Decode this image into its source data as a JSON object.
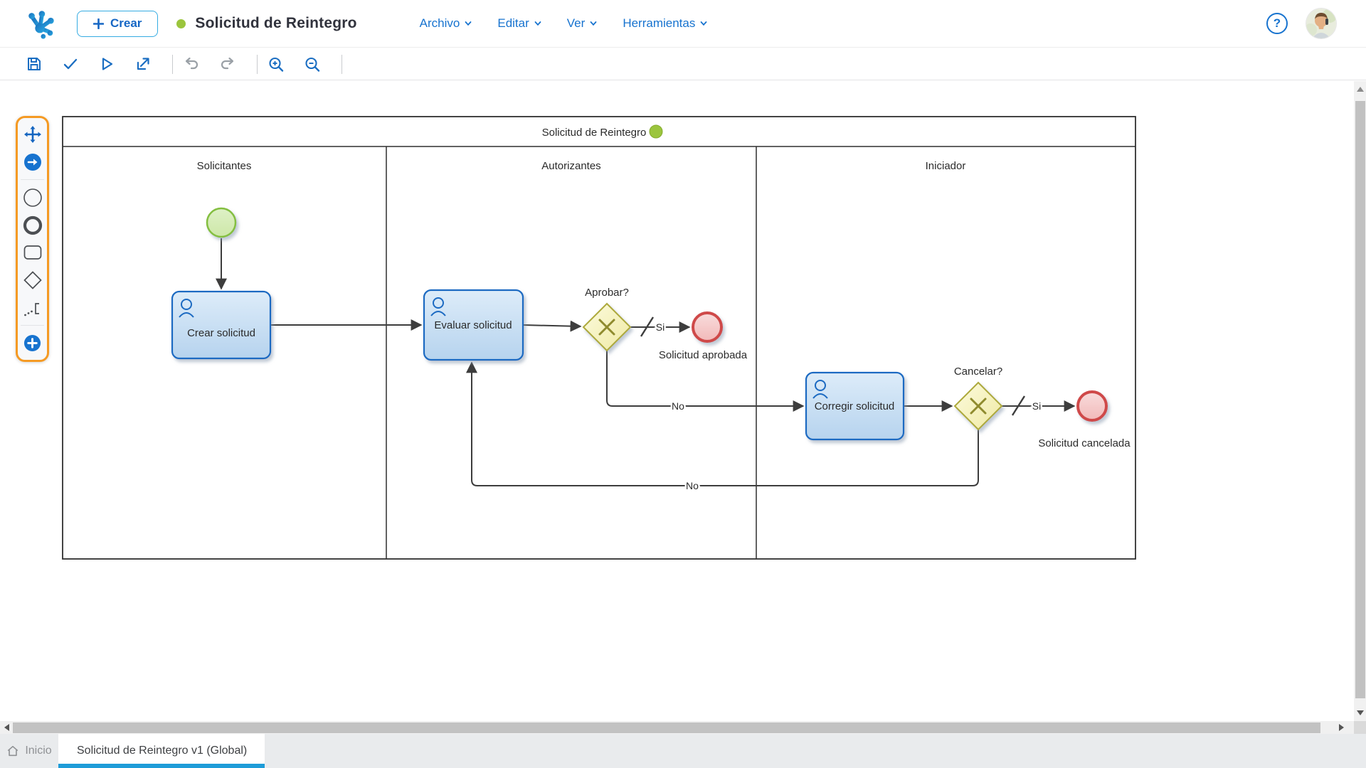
{
  "header": {
    "create_button_label": "Crear",
    "process_title": "Solicitud de Reintegro",
    "help_glyph": "?",
    "menus": [
      {
        "label": "Archivo"
      },
      {
        "label": "Editar"
      },
      {
        "label": "Ver"
      },
      {
        "label": "Herramientas"
      }
    ]
  },
  "toolbar": {
    "icons": [
      "save",
      "validate",
      "run",
      "export",
      "undo",
      "redo",
      "zoom-in",
      "zoom-out"
    ]
  },
  "palette": {
    "icons": [
      "move",
      "sequence-flow",
      "start-event",
      "end-event",
      "task",
      "gateway",
      "annotation",
      "add-element"
    ]
  },
  "diagram": {
    "pool_title": "Solicitud de Reintegro",
    "lanes": [
      {
        "label": "Solicitantes"
      },
      {
        "label": "Autorizantes"
      },
      {
        "label": "Iniciador"
      }
    ],
    "nodes": {
      "task_crear": "Crear solicitud",
      "task_evaluar": "Evaluar solicitud",
      "task_corregir": "Corregir solicitud",
      "gateway_aprobar": "Aprobar?",
      "gateway_cancelar": "Cancelar?",
      "end_aprobada": "Solicitud aprobada",
      "end_cancelada": "Solicitud cancelada"
    },
    "flow_labels": {
      "aprobar_si": "Si",
      "aprobar_no": "No",
      "cancelar_si": "Si",
      "cancelar_no": "No"
    }
  },
  "tabs": {
    "home_label": "Inicio",
    "active_label": "Solicitud de Reintegro v1 (Global)"
  },
  "colors": {
    "accent_blue": "#1773cf",
    "palette_orange": "#f59a23",
    "tab_underline": "#1e9cd8",
    "status_green": "#9bc53d",
    "task_border": "#1b6ac2",
    "start_border": "#84bf41",
    "end_border": "#cf4a4a",
    "gateway_border": "#ada93b"
  }
}
